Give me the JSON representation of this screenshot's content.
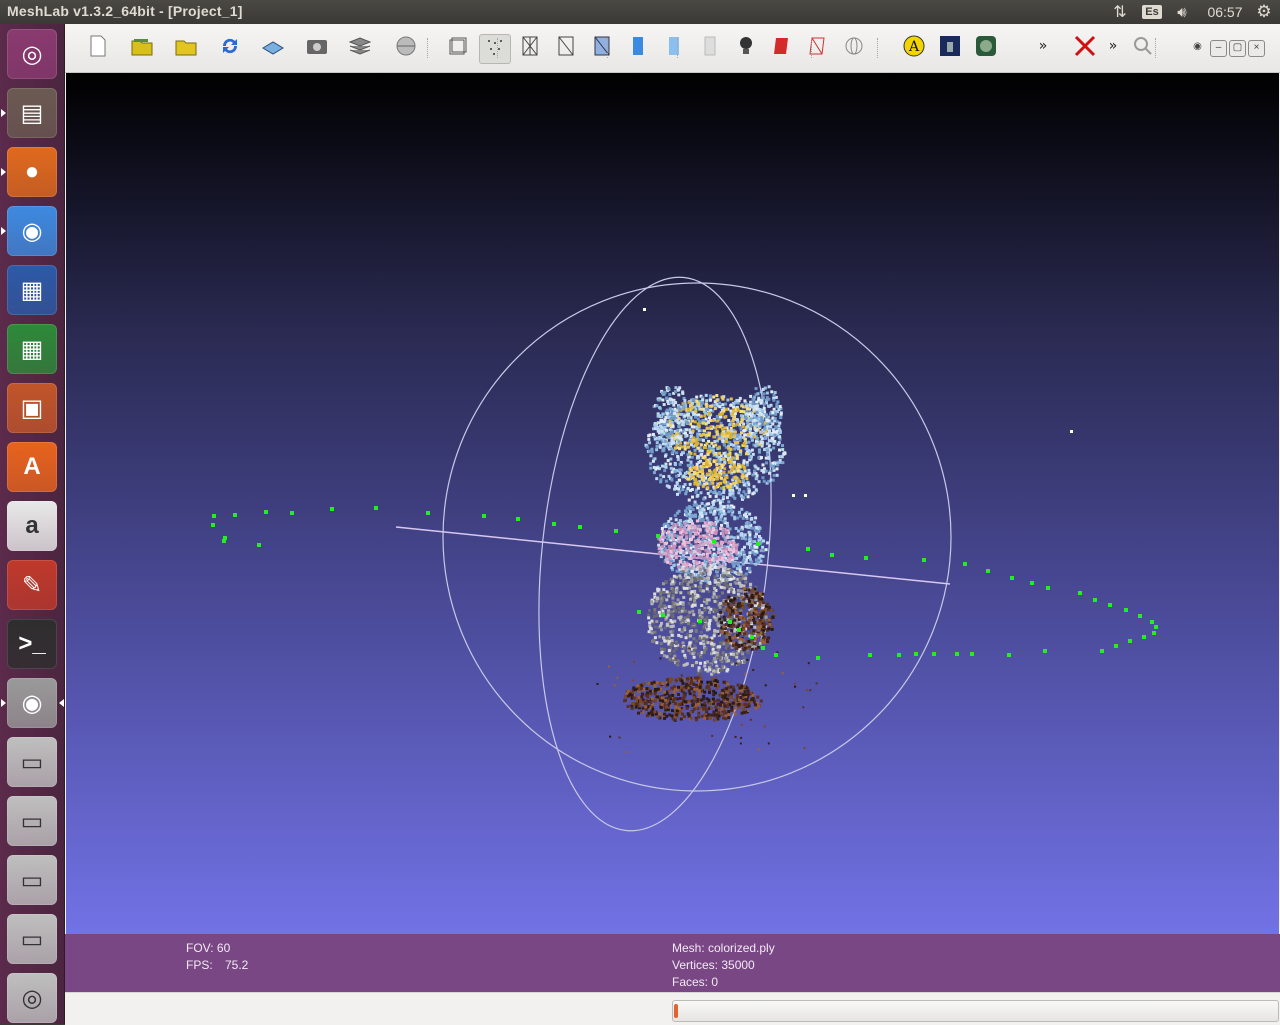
{
  "window": {
    "title": "MeshLab v1.3.2_64bit - [Project_1]"
  },
  "panel": {
    "keyboard_layout": "Es",
    "clock": "06:57"
  },
  "launcher": {
    "items": [
      {
        "name": "dash-home",
        "icon": "ubuntu-logo-icon",
        "color": "#8a3a70"
      },
      {
        "name": "files",
        "icon": "file-cabinet-icon",
        "color": "#6b5a52"
      },
      {
        "name": "firefox",
        "icon": "firefox-icon",
        "color": "#e06a1c"
      },
      {
        "name": "chrome",
        "icon": "chrome-icon",
        "color": "#3d8ae0"
      },
      {
        "name": "libreoffice-writer",
        "icon": "writer-document-icon",
        "color": "#2c5aa8"
      },
      {
        "name": "libreoffice-calc",
        "icon": "calc-spreadsheet-icon",
        "color": "#2d8a3a"
      },
      {
        "name": "libreoffice-impress",
        "icon": "impress-presentation-icon",
        "color": "#c2552a"
      },
      {
        "name": "software-center",
        "icon": "shopping-bag-icon",
        "color": "#e8631d"
      },
      {
        "name": "amazon",
        "icon": "amazon-icon",
        "color": "#e9e9e9"
      },
      {
        "name": "system-settings",
        "icon": "wrench-gear-icon",
        "color": "#c0392b"
      },
      {
        "name": "terminal",
        "icon": "terminal-icon",
        "color": "#2e2e2e"
      },
      {
        "name": "meshlab",
        "icon": "eye-icon",
        "color": "#9a9a9a"
      },
      {
        "name": "drive-1",
        "icon": "hard-drive-icon",
        "color": "#bfbfbf"
      },
      {
        "name": "drive-2",
        "icon": "hard-drive-icon",
        "color": "#bfbfbf"
      },
      {
        "name": "drive-3",
        "icon": "hard-drive-icon",
        "color": "#bfbfbf"
      },
      {
        "name": "drive-4",
        "icon": "hard-drive-icon",
        "color": "#bfbfbf"
      },
      {
        "name": "dvd",
        "icon": "dvd-icon",
        "color": "#bfbfbf"
      }
    ]
  },
  "toolbar": {
    "buttons": [
      "new-project-icon",
      "open-project-icon",
      "open-mesh-icon",
      "reload-icon",
      "save-icon",
      "snapshot-icon",
      "layers-icon",
      "bounding-box-globe-icon",
      "bbox-render-icon",
      "points-render-icon",
      "wireframe-icon",
      "hidden-lines-icon",
      "flat-lines-icon",
      "flat-render-icon",
      "smooth-render-icon",
      "texture-icon",
      "light-on-icon",
      "color-by-face-icon",
      "color-per-vertex-icon",
      "trackball-icon",
      "annotation-a-icon",
      "raster-icon",
      "color-texture-icon",
      "overflow-chevron-icon",
      "delete-red-icon",
      "overflow-chevron-icon-2",
      "search-icon"
    ],
    "active": "points-render-icon"
  },
  "info": {
    "fov": "FOV: 60",
    "fps_label": "FPS:",
    "fps": "75.2",
    "mesh": "Mesh: colorized.ply",
    "vertices": "Vertices: 35000",
    "faces": "Faces: 0"
  },
  "progress": {
    "value": 0.005
  },
  "colors": {
    "viewport_top": "#000000",
    "viewport_bottom": "#7272e6",
    "info_bar": "#7a4785",
    "camera_points": "#22ee22"
  }
}
